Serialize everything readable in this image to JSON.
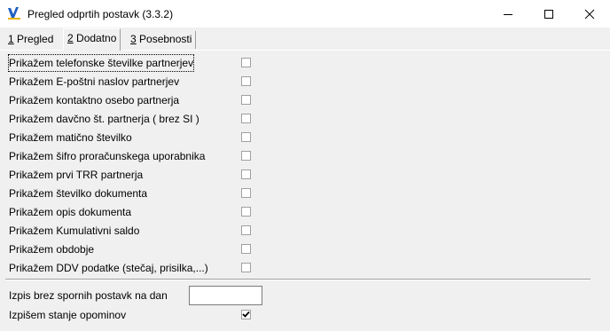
{
  "window": {
    "title": "Pregled odprtih postavk  (3.3.2)"
  },
  "tabs": [
    {
      "key": "1",
      "rest": " Pregled"
    },
    {
      "key": "2",
      "rest": " Dodatno"
    },
    {
      "key": "3",
      "rest": " Posebnosti"
    }
  ],
  "active_tab": "2 Dodatno",
  "options": [
    {
      "label": "Prikažem telefonske številke partnerjev",
      "checked": false
    },
    {
      "label": "Prikažem E-poštni naslov partnerjev",
      "checked": false
    },
    {
      "label": "Prikažem kontaktno osebo partnerja",
      "checked": false
    },
    {
      "label": "Prikažem davčno št. partnerja ( brez SI )",
      "checked": false
    },
    {
      "label": "Prikažem matično številko",
      "checked": false
    },
    {
      "label": "Prikažem šifro proračunskega uporabnika",
      "checked": false
    },
    {
      "label": "Prikažem prvi TRR partnerja",
      "checked": false
    },
    {
      "label": "Prikažem številko dokumenta",
      "checked": false
    },
    {
      "label": "Prikažem opis dokumenta",
      "checked": false
    },
    {
      "label": "Prikažem Kumulativni saldo",
      "checked": false
    },
    {
      "label": "Prikažem obdobje",
      "checked": false
    },
    {
      "label": "Prikažem DDV podatke (stečaj, prisilka,...)",
      "checked": false
    }
  ],
  "date_filter": {
    "label": "Izpis brez spornih postavk na dan",
    "value": ""
  },
  "reminder_option": {
    "label": "Izpišem stanje opominov",
    "checked": true
  },
  "icons": [
    "app-logo-icon",
    "minimize-icon",
    "maximize-icon",
    "close-icon",
    "checkmark-icon"
  ],
  "colors": {
    "logo_blue": "#1f5fbf",
    "logo_yellow": "#e8b400",
    "background": "#f0f0f0"
  }
}
